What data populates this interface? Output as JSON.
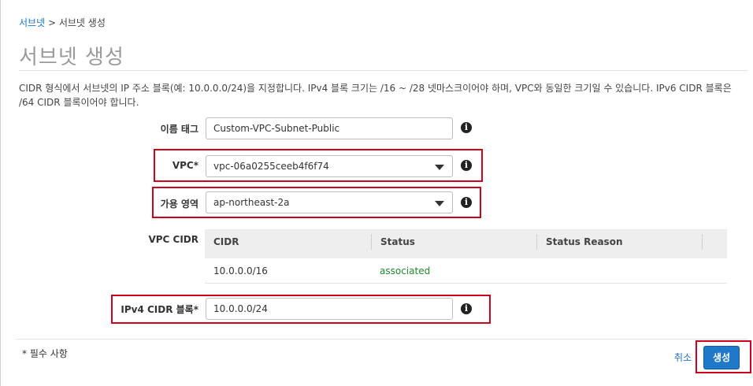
{
  "breadcrumb": {
    "parent": "서브넷",
    "separator": ">",
    "current": "서브넷 생성"
  },
  "page_title": "서브넷 생성",
  "description": "CIDR 형식에서 서브넷의 IP 주소 블록(예: 10.0.0.0/24)을 지정합니다. IPv4 블록 크기는 /16 ~ /28 넷마스크이어야 하며, VPC와 동일한 크기일 수 있습니다. IPv6 CIDR 블록은 /64 CIDR 블록이어야 합니다.",
  "form": {
    "name_tag": {
      "label": "이름 태그",
      "value": "Custom-VPC-Subnet-Public"
    },
    "vpc": {
      "label": "VPC*",
      "value": "vpc-06a0255ceeb4f6f74"
    },
    "az": {
      "label": "가용 영역",
      "value": "ap-northeast-2a"
    },
    "vpc_cidr": {
      "label": "VPC CIDR",
      "columns": [
        "CIDR",
        "Status",
        "Status Reason"
      ],
      "rows": [
        {
          "cidr": "10.0.0.0/16",
          "status": "associated",
          "reason": ""
        }
      ]
    },
    "ipv4": {
      "label": "IPv4 CIDR 블록*",
      "value": "10.0.0.0/24"
    }
  },
  "footer": {
    "required_note": "* 필수 사항",
    "cancel_label": "취소",
    "create_label": "생성"
  },
  "icons": {
    "info": "info-icon",
    "dropdown": "chevron-down-icon"
  },
  "colors": {
    "link": "#1a73c8",
    "primary_button": "#1f78c8",
    "highlight_box": "#d0021b",
    "status_associated": "#1e8a2e"
  }
}
